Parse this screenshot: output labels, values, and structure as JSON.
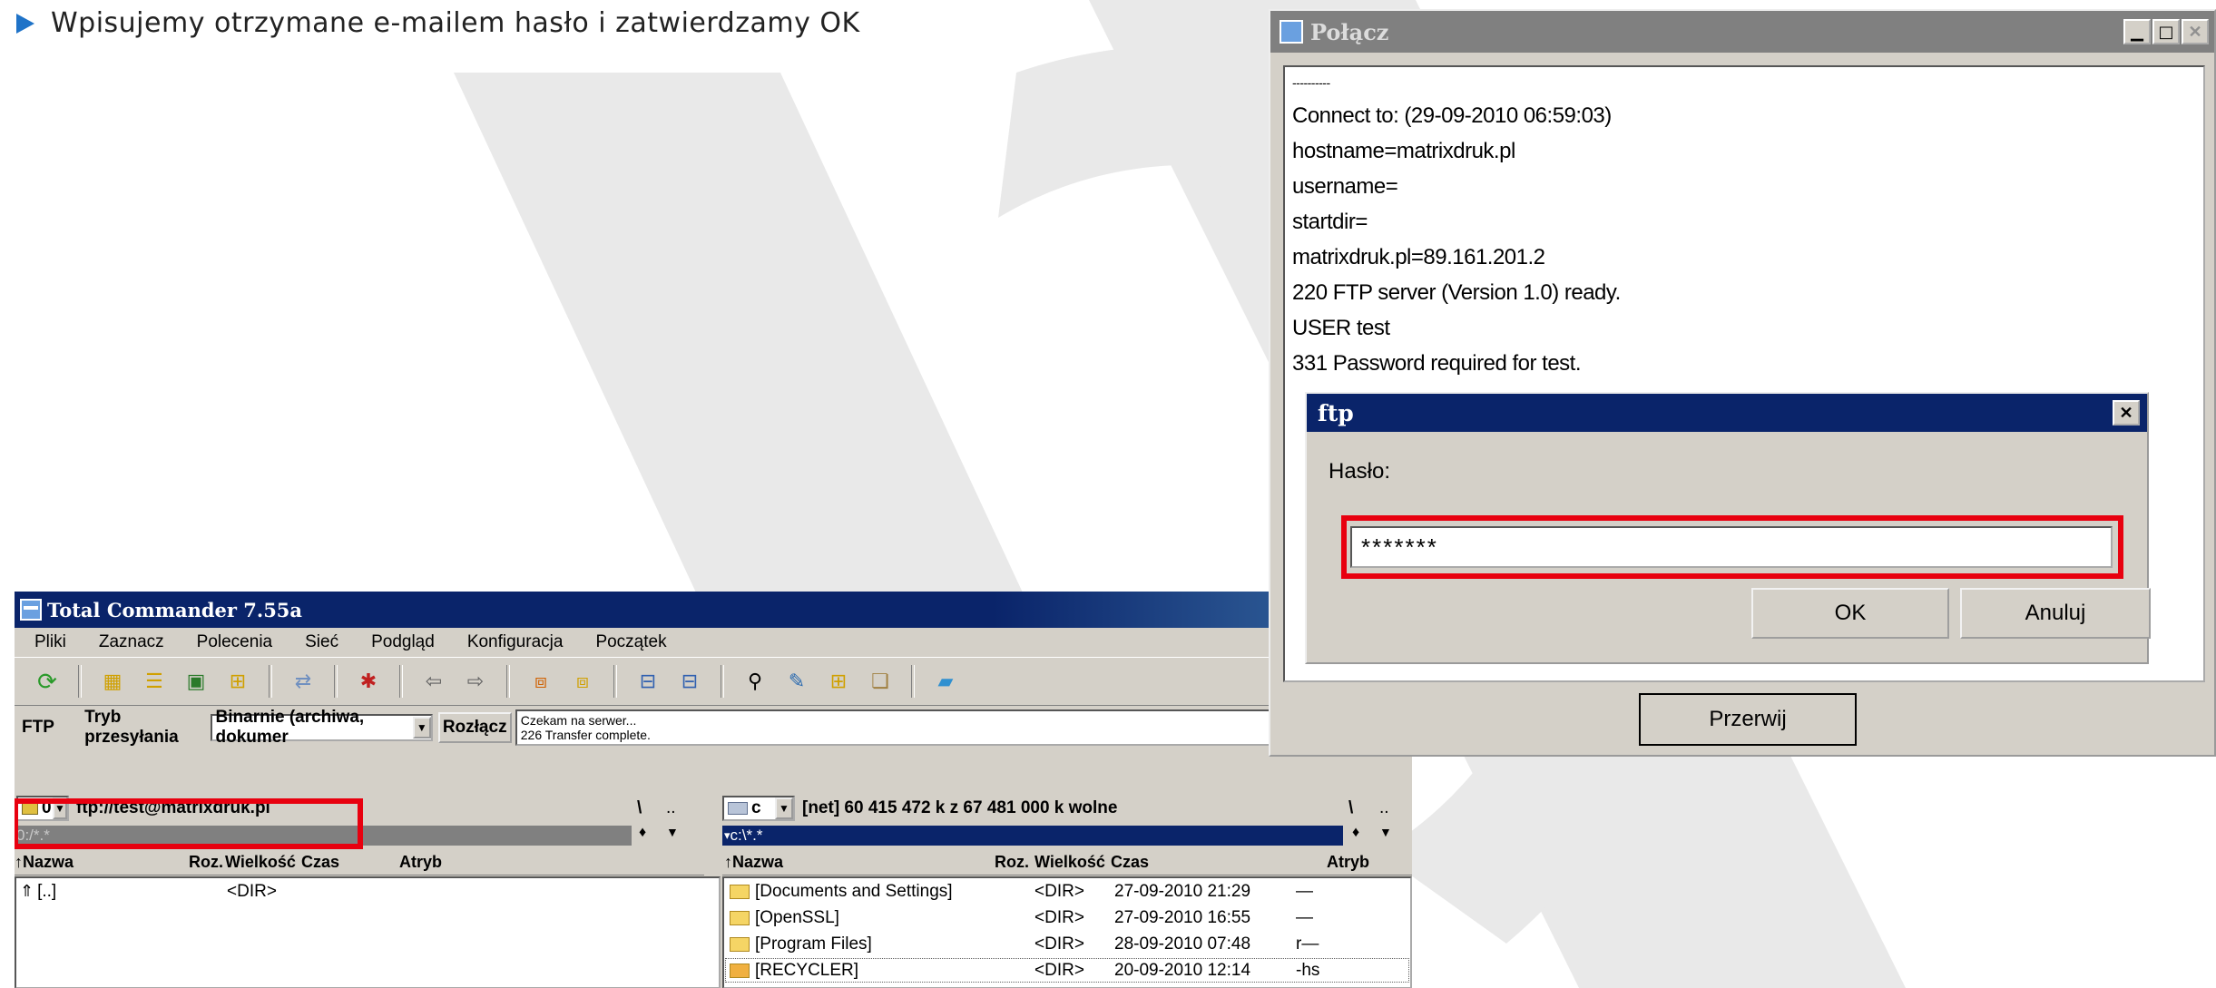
{
  "heading": {
    "text": "Wpisujemy otrzymane e-mailem hasło i zatwierdzamy OK",
    "bullet_color": "#1f73c8"
  },
  "tc": {
    "title": "Total Commander 7.55a",
    "menu": [
      "Pliki",
      "Zaznacz",
      "Polecenia",
      "Sieć",
      "Podgląd",
      "Konfiguracja",
      "Początek"
    ],
    "ftp_label": "FTP",
    "mode_label": "Tryb przesyłania",
    "mode_value": "Binarnie (archiwa, dokumer",
    "disconnect": "Rozłącz",
    "log": [
      "Czekam na serwer...",
      "226 Transfer complete."
    ],
    "left": {
      "drive": "0",
      "path_label": "ftp://test@matrixdruk.pl",
      "filter": "0:/*.*",
      "columns": [
        "Nazwa",
        "Roz.",
        "Wielkość",
        "Czas",
        "Atryb"
      ],
      "rows": [
        {
          "name": "[..]",
          "size": "<DIR>"
        }
      ]
    },
    "right": {
      "drive": "c",
      "drive_info": "[net]  60 415 472 k z 67 481 000 k wolne",
      "filter": "c:\\*.*",
      "columns": [
        "Nazwa",
        "Roz.",
        "Wielkość",
        "Czas",
        "Atryb"
      ],
      "rows": [
        {
          "name": "[Documents and Settings]",
          "size": "<DIR>",
          "time": "27-09-2010 21:29",
          "attr": "—"
        },
        {
          "name": "[OpenSSL]",
          "size": "<DIR>",
          "time": "27-09-2010 16:55",
          "attr": "—"
        },
        {
          "name": "[Program Files]",
          "size": "<DIR>",
          "time": "28-09-2010 07:48",
          "attr": "r—"
        },
        {
          "name": "[RECYCLER]",
          "size": "<DIR>",
          "time": "20-09-2010 12:14",
          "attr": "-hs"
        }
      ]
    },
    "backslash": "\\",
    "dots": "..",
    "star": "*"
  },
  "connect": {
    "title": "Połącz",
    "log_dashes": "----------",
    "log": [
      "Connect to: (29-09-2010 06:59:03)",
      "hostname=matrixdruk.pl",
      "username=",
      "startdir=",
      "matrixdruk.pl=89.161.201.2",
      "220 FTP server (Version 1.0) ready.",
      "USER test",
      "331 Password required for test."
    ],
    "abort": "Przerwij"
  },
  "ftp_dialog": {
    "title": "ftp",
    "label": "Hasło:",
    "password": "*******",
    "ok": "OK",
    "cancel": "Anuluj"
  },
  "highlight_color": "#e8000f"
}
